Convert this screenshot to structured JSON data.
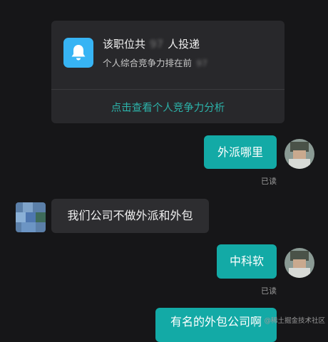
{
  "job_card": {
    "title_prefix": "该职位共",
    "title_count": "97",
    "title_suffix": "人投递",
    "rank_prefix": "个人综合竞争力排在前",
    "rank_value": "97",
    "link_label": "点击查看个人竞争力分析",
    "icon": "bell-icon",
    "icon_color": "#37b4f4"
  },
  "messages": [
    {
      "sender": "me",
      "text": "外派哪里",
      "status": "已读"
    },
    {
      "sender": "other",
      "text": "我们公司不做外派和外包"
    },
    {
      "sender": "me",
      "text": "中科软",
      "status": "已读"
    },
    {
      "sender": "me",
      "text": "有名的外包公司啊"
    }
  ],
  "colors": {
    "background": "#161618",
    "card": "#28282b",
    "my_bubble": "#13aaa6",
    "other_bubble": "#2d2d30",
    "link": "#2cb3aa"
  },
  "watermark": "@稀土掘金技术社区"
}
